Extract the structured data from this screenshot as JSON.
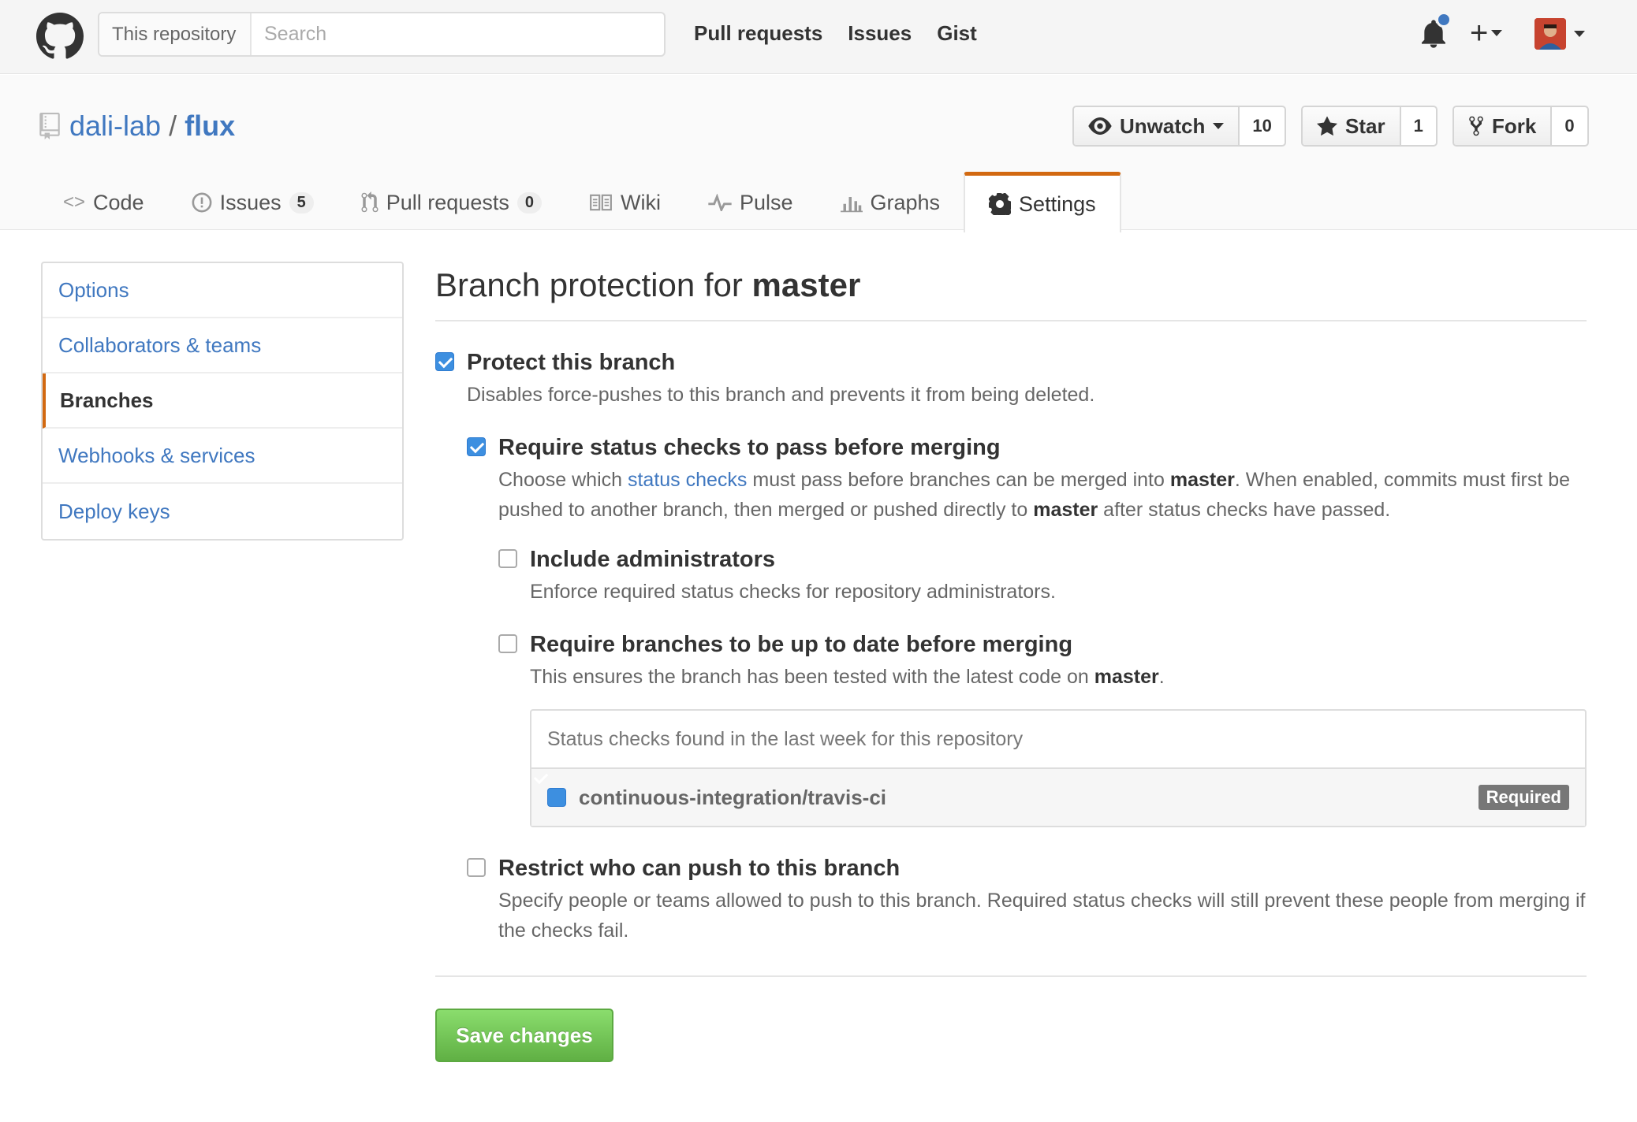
{
  "header": {
    "search_scope": "This repository",
    "search_placeholder": "Search",
    "nav": [
      "Pull requests",
      "Issues",
      "Gist"
    ],
    "plus_label": "+"
  },
  "repo": {
    "owner": "dali-lab",
    "separator": "/",
    "name": "flux",
    "watch_label": "Unwatch",
    "watch_count": "10",
    "star_label": "Star",
    "star_count": "1",
    "fork_label": "Fork",
    "fork_count": "0"
  },
  "tabs": [
    {
      "label": "Code",
      "icon": "code-icon"
    },
    {
      "label": "Issues",
      "icon": "issue-icon",
      "count": "5"
    },
    {
      "label": "Pull requests",
      "icon": "pull-request-icon",
      "count": "0"
    },
    {
      "label": "Wiki",
      "icon": "book-icon"
    },
    {
      "label": "Pulse",
      "icon": "pulse-icon"
    },
    {
      "label": "Graphs",
      "icon": "graph-icon"
    },
    {
      "label": "Settings",
      "icon": "gear-icon",
      "selected": true
    }
  ],
  "sidebar": {
    "items": [
      "Options",
      "Collaborators & teams",
      "Branches",
      "Webhooks & services",
      "Deploy keys"
    ],
    "active": "Branches"
  },
  "main": {
    "title_prefix": "Branch protection for ",
    "title_branch": "master",
    "protect": {
      "title": "Protect this branch",
      "desc": "Disables force-pushes to this branch and prevents it from being deleted.",
      "checked": true
    },
    "status_checks": {
      "title": "Require status checks to pass before merging",
      "desc_1": "Choose which ",
      "desc_link": "status checks",
      "desc_2": " must pass before branches can be merged into ",
      "desc_branch_1": "master",
      "desc_3": ". When enabled, commits must first be pushed to another branch, then merged or pushed directly to ",
      "desc_branch_2": "master",
      "desc_4": " after status checks have passed.",
      "checked": true
    },
    "include_admins": {
      "title": "Include administrators",
      "desc": "Enforce required status checks for repository administrators.",
      "checked": false
    },
    "up_to_date": {
      "title": "Require branches to be up to date before merging",
      "desc_1": "This ensures the branch has been tested with the latest code on ",
      "desc_branch": "master",
      "desc_2": ".",
      "checked": false
    },
    "status_box": {
      "header": "Status checks found in the last week for this repository",
      "check_name": "continuous-integration/travis-ci",
      "check_checked": true,
      "badge": "Required"
    },
    "restrict": {
      "title": "Restrict who can push to this branch",
      "desc": "Specify people or teams allowed to push to this branch. Required status checks will still prevent these people from merging if the checks fail.",
      "checked": false
    },
    "save_label": "Save changes"
  },
  "colors": {
    "link": "#4078c0",
    "accent_orange": "#d26911",
    "checkbox_blue": "#3d8fe0",
    "save_green": "#60b044"
  }
}
